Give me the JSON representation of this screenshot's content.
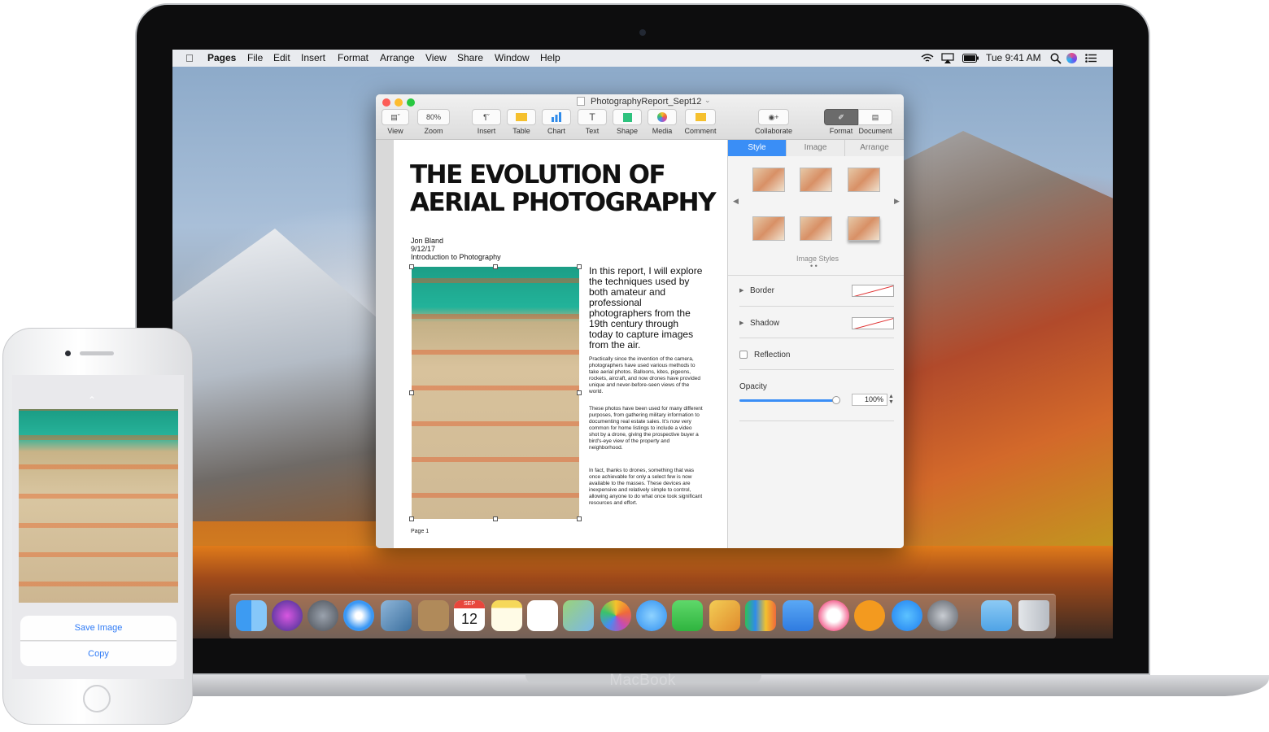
{
  "device": {
    "laptop_brand": "MacBook"
  },
  "menubar": {
    "app_name": "Pages",
    "items": [
      "File",
      "Edit",
      "Insert",
      "Format",
      "Arrange",
      "View",
      "Share",
      "Window",
      "Help"
    ],
    "clock": "Tue 9:41 AM"
  },
  "window": {
    "title": "PhotographyReport_Sept12",
    "toolbar": {
      "view": "View",
      "zoom_value": "80%",
      "zoom": "Zoom",
      "insert": "Insert",
      "table": "Table",
      "chart": "Chart",
      "text": "Text",
      "shape": "Shape",
      "media": "Media",
      "comment": "Comment",
      "collaborate": "Collaborate",
      "format": "Format",
      "document": "Document"
    },
    "sidebar": {
      "tabs": [
        "Style",
        "Image",
        "Arrange"
      ],
      "image_styles_label": "Image Styles",
      "border": "Border",
      "shadow": "Shadow",
      "reflection": "Reflection",
      "opacity": "Opacity",
      "opacity_value": "100%",
      "opacity_fraction": 1.0
    }
  },
  "article": {
    "headline_line1": "THE EVOLUTION OF",
    "headline_line2": "AERIAL PHOTOGRAPHY",
    "author": "Jon Bland",
    "date": "9/12/17",
    "course": "Introduction to Photography",
    "lead": "In this report, I will explore the techniques used by both amateur and professional photographers from the 19th century through today to capture images from the air.",
    "para1": "Practically since the invention of the camera, photographers have used various methods to take aerial photos. Balloons, kites, pigeons, rockets, aircraft, and now drones have provided unique and never-before-seen views of the world.",
    "para2": "These photos have been used for many different purposes, from gathering military information to documenting real estate sales. It's now very common for home listings to include a video shot by a drone, giving the prospective buyer a bird's-eye view of the property and neighborhood.",
    "para3": "In fact, thanks to drones, something that was once achievable for only a select few is now available to the masses. These devices are inexpensive and relatively simple to control, allowing anyone to do what once took significant resources and effort.",
    "page_label": "Page 1"
  },
  "calendar_icon": {
    "month": "SEP",
    "day": "12"
  },
  "iphone": {
    "save_image": "Save Image",
    "copy": "Copy"
  },
  "colors": {
    "accent_blue": "#3a8ef6",
    "ios_blue": "#2f7bf6"
  }
}
